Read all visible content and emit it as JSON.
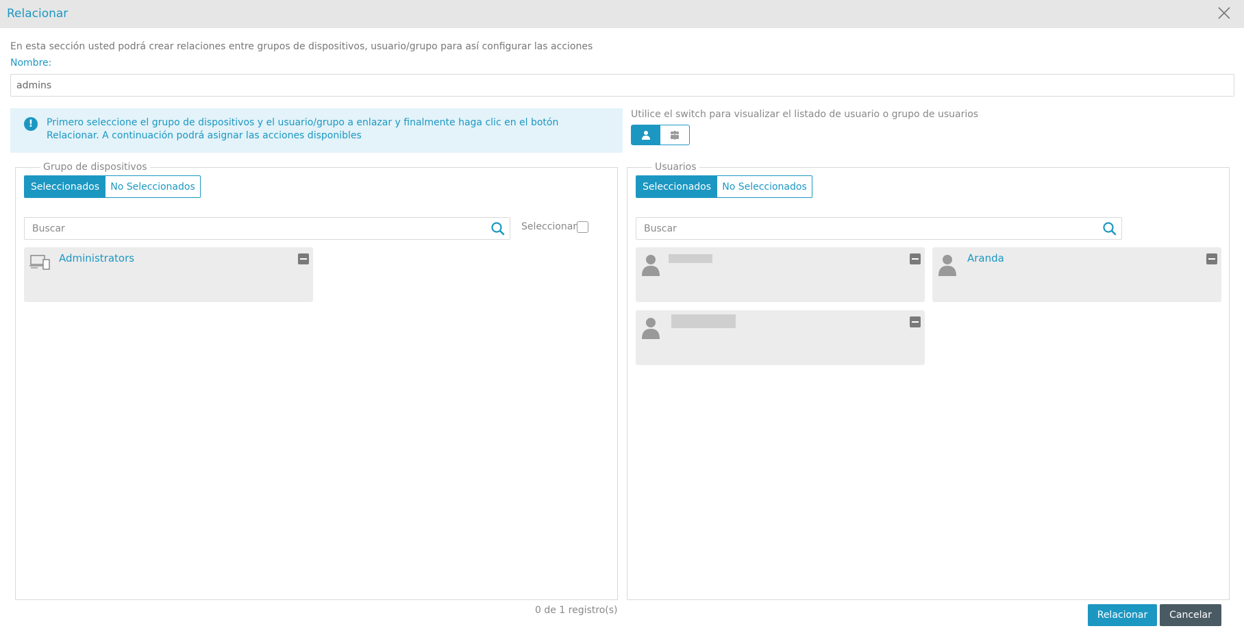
{
  "dialog": {
    "title": "Relacionar",
    "intro": "En esta sección usted podrá crear relaciones entre grupos de dispositivos, usuario/grupo para así configurar las acciones",
    "name_label": "Nombre:",
    "name_value": "admins"
  },
  "info": {
    "icon": "!",
    "text": "Primero seleccione el grupo de dispositivos y el usuario/grupo a enlazar y finalmente haga clic en el botón Relacionar. A continuación podrá asignar las acciones disponibles"
  },
  "switch": {
    "hint": "Utilice el switch para visualizar el listado de usuario o grupo de usuarios",
    "options": [
      "user-icon",
      "user-group-icon"
    ],
    "selected": "user-icon"
  },
  "left_panel": {
    "legend": "Grupo de dispositivos",
    "tab_selected": "Seleccionados",
    "tab_not_selected": "No Seleccionados",
    "search_placeholder": "Buscar",
    "select_label": "Seleccionar",
    "items": [
      {
        "name": "Administrators",
        "icon": "devices-icon"
      }
    ]
  },
  "right_panel": {
    "legend": "Usuarios",
    "tab_selected": "Seleccionados",
    "tab_not_selected": "No Seleccionados",
    "search_placeholder": "Buscar",
    "items": [
      {
        "name": "",
        "icon": "user-icon",
        "redacted": true
      },
      {
        "name": "Aranda",
        "icon": "user-icon"
      },
      {
        "name": "",
        "icon": "user-icon",
        "redacted": true
      }
    ]
  },
  "footer": {
    "count": "0 de 1 registro(s)",
    "relate_label": "Relacionar",
    "cancel_label": "Cancelar"
  },
  "colors": {
    "accent": "#1c97c2",
    "cancel": "#4a5a63",
    "info_bg": "#e3f3f9",
    "card_bg": "#ececec"
  }
}
